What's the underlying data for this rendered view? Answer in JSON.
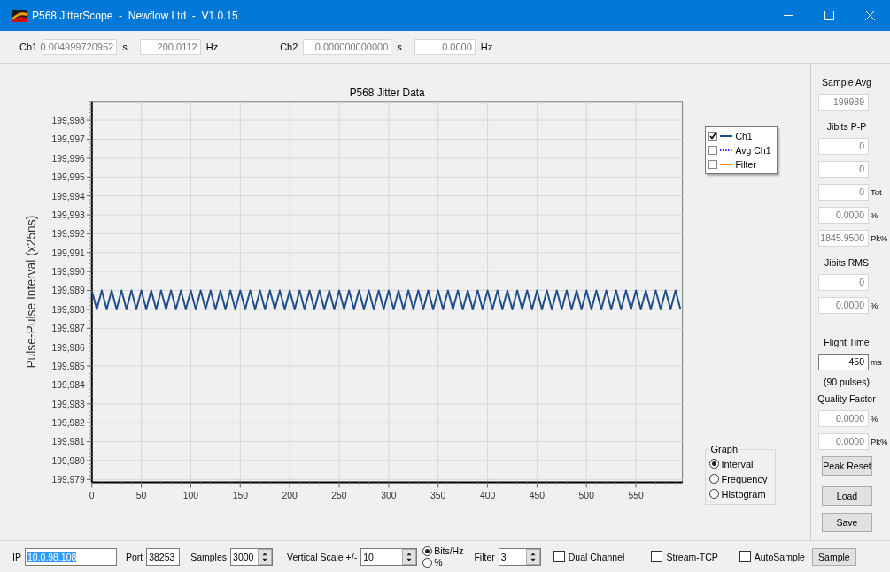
{
  "window": {
    "title": "P568 JitterScope  -  Newflow Ltd  -  V1.0.15"
  },
  "channels": [
    {
      "label": "Ch1",
      "period": "0.004999720952",
      "period_unit": "s",
      "frequency": "200.0112",
      "frequency_unit": "Hz"
    },
    {
      "label": "Ch2",
      "period": "0.000000000000",
      "period_unit": "s",
      "frequency": "0.0000",
      "frequency_unit": "Hz"
    }
  ],
  "chart": {
    "chart_data": {
      "type": "line",
      "grid": true,
      "title": "P568 Jitter Data",
      "ylabel": "Pulse-Pulse Interval (x25ns)",
      "xlim": [
        0,
        597
      ],
      "ylim": [
        199978.85,
        199999
      ],
      "xticks": [
        0,
        50,
        100,
        150,
        200,
        250,
        300,
        350,
        400,
        450,
        500,
        550
      ],
      "yticks": [
        {
          "value": 199998,
          "label": "199,998"
        },
        {
          "value": 199997,
          "label": "199,997"
        },
        {
          "value": 199996,
          "label": "199,996"
        },
        {
          "value": 199995,
          "label": "199,995"
        },
        {
          "value": 199994,
          "label": "199,994"
        },
        {
          "value": 199993,
          "label": "199,993"
        },
        {
          "value": 199992,
          "label": "199,992"
        },
        {
          "value": 199991,
          "label": "199,991"
        },
        {
          "value": 199990,
          "label": "199,990"
        },
        {
          "value": 199989,
          "label": "199,989"
        },
        {
          "value": 199988,
          "label": "199,988"
        },
        {
          "value": 199987,
          "label": "199,987"
        },
        {
          "value": 199986,
          "label": "199,986"
        },
        {
          "value": 199985,
          "label": "199,985"
        },
        {
          "value": 199984,
          "label": "199,984"
        },
        {
          "value": 199983,
          "label": "199,983"
        },
        {
          "value": 199982,
          "label": "199,982"
        },
        {
          "value": 199981,
          "label": "199,981"
        },
        {
          "value": 199980,
          "label": "199,980"
        },
        {
          "value": 199979,
          "label": "199,979"
        }
      ],
      "x": [
        0,
        5,
        10,
        15,
        20,
        25,
        30,
        35,
        40,
        45,
        50,
        55,
        60,
        65,
        70,
        75,
        80,
        85,
        90,
        95,
        100,
        105,
        110,
        115,
        120,
        125,
        130,
        135,
        140,
        145,
        150,
        155,
        160,
        165,
        170,
        175,
        180,
        185,
        190,
        195,
        200,
        205,
        210,
        215,
        220,
        225,
        230,
        235,
        240,
        245,
        250,
        255,
        260,
        265,
        270,
        275,
        280,
        285,
        290,
        295,
        300,
        305,
        310,
        315,
        320,
        325,
        330,
        335,
        340,
        345,
        350,
        355,
        360,
        365,
        370,
        375,
        380,
        385,
        390,
        395,
        400,
        405,
        410,
        415,
        420,
        425,
        430,
        435,
        440,
        445,
        450,
        455,
        460,
        465,
        470,
        475,
        480,
        485,
        490,
        495,
        500,
        505,
        510,
        515,
        520,
        525,
        530,
        535,
        540,
        545,
        550,
        555,
        560,
        565,
        570,
        575,
        580,
        585,
        590,
        595
      ],
      "series": [
        {
          "color": "#1f4e8c",
          "values": [
            199989,
            199988,
            199989,
            199988,
            199989,
            199988,
            199989,
            199988,
            199989,
            199988,
            199989,
            199988,
            199989,
            199988,
            199989,
            199988,
            199989,
            199988,
            199989,
            199988,
            199989,
            199988,
            199989,
            199988,
            199989,
            199988,
            199989,
            199988,
            199989,
            199988,
            199989,
            199988,
            199989,
            199988,
            199989,
            199988,
            199989,
            199988,
            199989,
            199988,
            199989,
            199988,
            199989,
            199988,
            199989,
            199988,
            199989,
            199988,
            199989,
            199988,
            199989,
            199988,
            199989,
            199988,
            199989,
            199988,
            199989,
            199988,
            199989,
            199988,
            199989,
            199988,
            199989,
            199988,
            199989,
            199988,
            199989,
            199988,
            199989,
            199988,
            199989,
            199988,
            199989,
            199988,
            199989,
            199988,
            199989,
            199988,
            199989,
            199988,
            199989,
            199988,
            199989,
            199988,
            199989,
            199988,
            199989,
            199988,
            199989,
            199988,
            199989,
            199988,
            199989,
            199988,
            199989,
            199988,
            199989,
            199988,
            199989,
            199988,
            199989,
            199988,
            199989,
            199988,
            199989,
            199988,
            199989,
            199988,
            199989,
            199988,
            199989,
            199988,
            199989,
            199988,
            199989,
            199988,
            199989,
            199988,
            199989,
            199988
          ]
        }
      ]
    },
    "legend": [
      {
        "label": "Ch1",
        "checked": true,
        "color": "#1f4e8c",
        "kind": "solid"
      },
      {
        "label": "Avg Ch1",
        "checked": false,
        "color": "#3030ff",
        "kind": "dotted"
      },
      {
        "label": "Filter",
        "checked": false,
        "color": "#ff8c1a",
        "kind": "solid"
      }
    ],
    "graph_group": {
      "title": "Graph",
      "options": [
        {
          "label": "Interval",
          "selected": true
        },
        {
          "label": "Frequency",
          "selected": false
        },
        {
          "label": "Histogram",
          "selected": false
        }
      ]
    }
  },
  "side_panel": {
    "groups": [
      [
        {
          "kind": "label",
          "text": "Sample Avg"
        },
        {
          "kind": "field",
          "value": "199989",
          "disabled": true
        }
      ],
      [
        {
          "kind": "label",
          "text": "Jibits P-P"
        },
        {
          "kind": "field",
          "value": "0",
          "disabled": true
        },
        {
          "kind": "field",
          "value": "0",
          "disabled": true
        },
        {
          "kind": "field",
          "value": "0",
          "unit": "Tot",
          "disabled": true
        },
        {
          "kind": "field",
          "value": "0.0000",
          "unit": "%",
          "disabled": true
        },
        {
          "kind": "field",
          "value": "1845.9500",
          "unit": "Pk%",
          "disabled": true
        }
      ],
      [
        {
          "kind": "label",
          "text": "Jibits RMS"
        },
        {
          "kind": "field",
          "value": "0",
          "disabled": true
        },
        {
          "kind": "field",
          "value": "0.0000",
          "unit": "%",
          "disabled": true
        }
      ],
      [
        {
          "kind": "label",
          "text": "Flight Time"
        },
        {
          "kind": "field",
          "value": "450",
          "unit": "ms",
          "disabled": false
        },
        {
          "kind": "label",
          "text": "(90 pulses)"
        },
        {
          "kind": "label",
          "text": "Quality Factor"
        },
        {
          "kind": "field",
          "value": "0.0000",
          "unit": "%",
          "disabled": true
        },
        {
          "kind": "field",
          "value": "0.0000",
          "unit": "Pk%",
          "disabled": true
        },
        {
          "kind": "button",
          "text": "Peak Reset"
        }
      ],
      [
        {
          "kind": "button",
          "text": "Load"
        },
        {
          "kind": "button",
          "text": "Save"
        }
      ]
    ]
  },
  "bottom_bar": [
    {
      "kind": "field",
      "label": "IP",
      "value": "10.0.98.108",
      "selected": true
    },
    {
      "kind": "field",
      "label": "Port",
      "value": "38253",
      "selected": false
    },
    {
      "kind": "spinner",
      "label": "Samples",
      "value": "3000"
    },
    {
      "kind": "spinner",
      "label": "Vertical Scale +/-",
      "value": "10"
    },
    {
      "kind": "radios",
      "options": [
        {
          "label": "Bits/Hz",
          "selected": true
        },
        {
          "label": "%",
          "selected": false
        }
      ]
    },
    {
      "kind": "spinner",
      "label": "Filter",
      "value": "3"
    },
    {
      "kind": "checkbox",
      "label": "Dual Channel",
      "checked": false
    },
    {
      "kind": "checkbox",
      "label": "Stream-TCP",
      "checked": false
    },
    {
      "kind": "checkbox",
      "label": "AutoSample",
      "checked": false
    },
    {
      "kind": "button",
      "text": "Sample"
    }
  ]
}
